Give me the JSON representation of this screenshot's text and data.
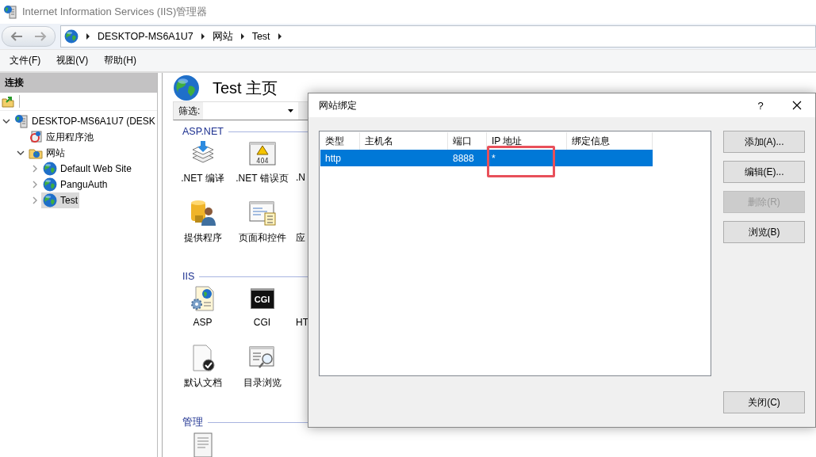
{
  "window": {
    "title": "Internet Information Services (IIS)管理器"
  },
  "nav": {
    "breadcrumbs": [
      "DESKTOP-MS6A1U7",
      "网站",
      "Test"
    ]
  },
  "menu": [
    "文件(F)",
    "视图(V)",
    "帮助(H)"
  ],
  "connections": {
    "title": "连接",
    "tree": [
      {
        "label": "DESKTOP-MS6A1U7 (DESK",
        "kind": "server",
        "expanded": true,
        "selected": false,
        "children": [
          {
            "label": "应用程序池",
            "kind": "pool",
            "selected": false
          },
          {
            "label": "网站",
            "kind": "folder",
            "expanded": true,
            "selected": false,
            "children": [
              {
                "label": "Default Web Site",
                "kind": "site",
                "expanded": false,
                "selected": false
              },
              {
                "label": "PanguAuth",
                "kind": "site",
                "expanded": false,
                "selected": false
              },
              {
                "label": "Test",
                "kind": "site",
                "expanded": false,
                "selected": true
              }
            ]
          }
        ]
      }
    ]
  },
  "main": {
    "title": "Test 主页",
    "filter": {
      "label": "筛选:"
    },
    "groups": [
      {
        "title": "ASP.NET",
        "features": [
          {
            "label": ".NET 编译",
            "kind": "compile"
          },
          {
            "label": ".NET 错误页",
            "kind": "error404",
            "icon_text": "404"
          },
          {
            "label": ".N",
            "kind": "partial"
          },
          {
            "label": "提供程序",
            "kind": "provider"
          },
          {
            "label": "页面和控件",
            "kind": "pages"
          },
          {
            "label": "应",
            "kind": "partial"
          }
        ]
      },
      {
        "title": "IIS",
        "features": [
          {
            "label": "ASP",
            "kind": "asp"
          },
          {
            "label": "CGI",
            "kind": "cgi",
            "icon_text": "CGI"
          },
          {
            "label": "HT",
            "kind": "partial"
          },
          {
            "label": "默认文档",
            "kind": "defaultdoc"
          },
          {
            "label": "目录浏览",
            "kind": "dirbrowse"
          }
        ]
      },
      {
        "title": "管理",
        "features": [
          {
            "kind": "doc"
          }
        ]
      }
    ]
  },
  "dialog": {
    "title": "网站绑定",
    "help": "?",
    "columns": [
      "类型",
      "主机名",
      "端口",
      "IP 地址",
      "绑定信息"
    ],
    "rows": [
      {
        "type": "http",
        "port": "8888",
        "ip": "*",
        "selected": true
      }
    ],
    "buttons": [
      {
        "label": "添加(A)...",
        "disabled": false
      },
      {
        "label": "编辑(E)...",
        "disabled": false
      },
      {
        "label": "删除(R)",
        "disabled": true
      },
      {
        "label": "浏览(B)",
        "disabled": false
      }
    ],
    "close": "关闭(C)"
  }
}
